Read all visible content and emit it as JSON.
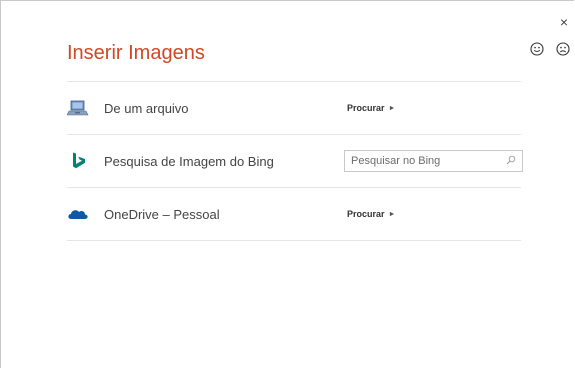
{
  "dialog": {
    "title": "Inserir Imagens",
    "close_glyph": "×",
    "feedback": {
      "smile_icon": "smile-icon",
      "frown_icon": "frown-icon"
    }
  },
  "rows": [
    {
      "label": "De um arquivo",
      "icon": "computer-icon",
      "action": "Procurar",
      "arrow": "►"
    },
    {
      "label": "Pesquisa de Imagem do Bing",
      "icon": "bing-icon",
      "search_placeholder": "Pesquisar no Bing",
      "search_icon": "search-icon"
    },
    {
      "label": "OneDrive – Pessoal",
      "icon": "onedrive-icon",
      "action": "Procurar",
      "arrow": "►"
    }
  ],
  "colors": {
    "title": "#d24726",
    "bing": "#008373",
    "onedrive": "#0f5aa8"
  }
}
